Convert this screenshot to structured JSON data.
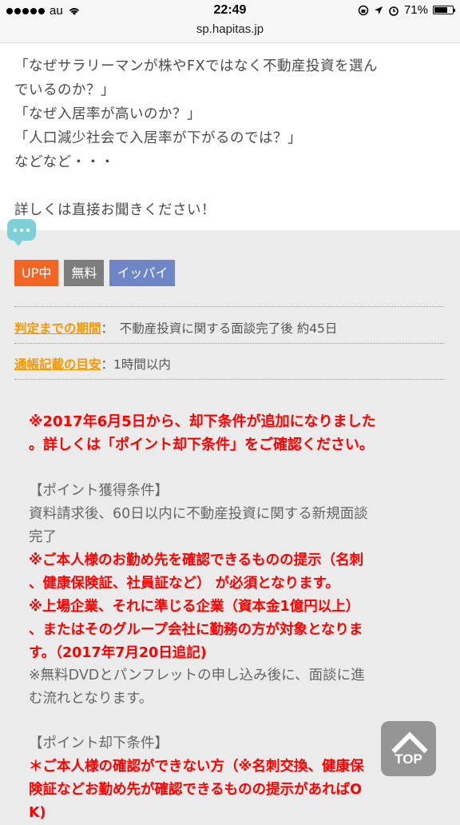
{
  "status": {
    "carrier": "au",
    "time": "22:49",
    "battery": "71%",
    "battery_level": 0.71
  },
  "url": "sp.hapitas.jp",
  "intro": {
    "lines": [
      "「なぜサラリーマンが株やFXではなく不動産投資を選ん",
      "でいるのか？」",
      "「なぜ入居率が高いのか？」",
      "「人口減少社会で入居率が下がるのでは？」",
      "などなど・・・"
    ],
    "closing": "詳しくは直接お聞きください！"
  },
  "tags": [
    "UP中",
    "無料",
    "イッパイ"
  ],
  "info": {
    "period_label": "判定までの期間",
    "period_value": "：　不動産投資に関する面談完了後 約45日",
    "passbook_label": "通帳記載の目安",
    "passbook_value": "：1時間以内"
  },
  "notice": [
    "※2017年6月5日から、却下条件が追加になりました",
    "。詳しくは「ポイント却下条件」をご確認ください。"
  ],
  "conditions": {
    "heading": "【ポイント獲得条件】",
    "text": [
      "資料請求後、60日以内に不動産投資に関する新規面談",
      "完了"
    ],
    "red": [
      "※ご本人様のお勤め先を確認できるものの提示（名刺",
      "、健康保険証、社員証など） が必須となります。",
      "※上場企業、それに準じる企業（資本金1億円以上）",
      "、またはそのグループ会社に勤務の方が対象となりま",
      "す。（2017年7月20日追記)"
    ],
    "note": [
      "※無料DVDとパンフレットの申し込み後に、面談に進",
      "む流れとなります。"
    ]
  },
  "reject": {
    "heading": "【ポイント却下条件】",
    "red": [
      "＊ご本人様の確認ができない方（※名刺交換、健康保",
      "険証などお勤め先が確認できるものの提示があればO",
      "K)"
    ]
  },
  "top_button": "TOP"
}
